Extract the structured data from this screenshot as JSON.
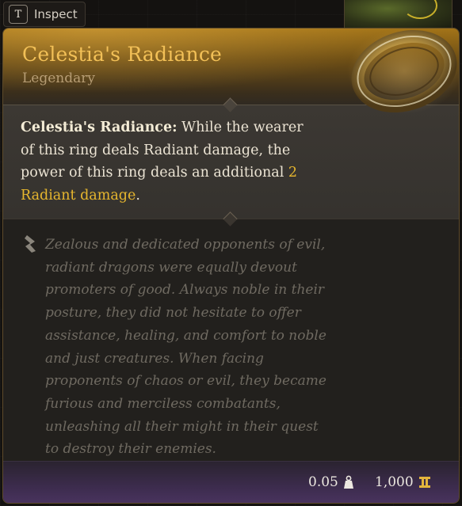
{
  "inspect": {
    "key": "T",
    "label": "Inspect"
  },
  "item": {
    "name": "Celestia's Radiance",
    "rarity": "Legendary",
    "ability": {
      "label": "Celestia's Radiance:",
      "text_before": " While the wearer of this ring deals Radiant damage, the power of this ring deals an additional ",
      "highlight": "2 Radiant damage",
      "text_after": "."
    },
    "lore": "Zealous and dedicated opponents of evil, radiant dragons were equally devout promoters of good. Always noble in their posture, they did not hesitate to offer assistance, healing, and comfort to noble and just creatures. When facing proponents of chaos or evil, they became furious and merciless combatants, unleashing all their might in their quest to destroy their enemies.",
    "weight": "0.05",
    "price": "1,000"
  },
  "icons": {
    "item": "gold-ring-icon",
    "lore": "quill-icon",
    "weight": "weight-icon",
    "price": "gold-coin-icon"
  },
  "colors": {
    "title": "#f2c057",
    "highlight": "#e6b62e",
    "rarity": "#b79d74"
  }
}
